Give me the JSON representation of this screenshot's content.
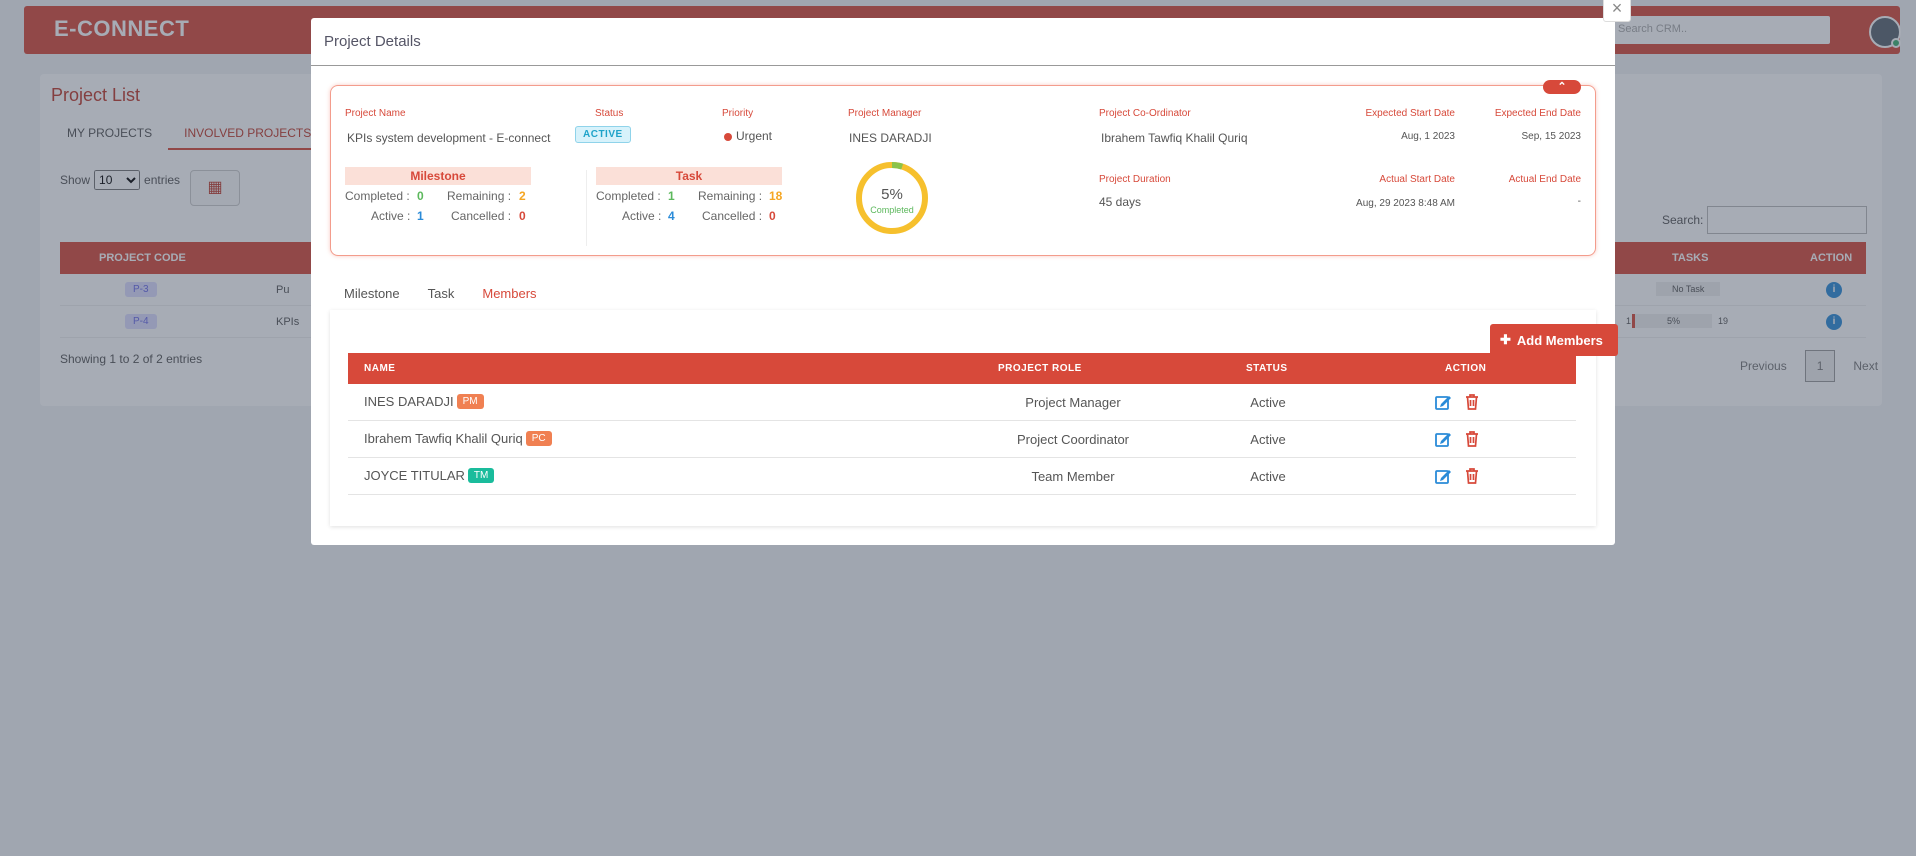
{
  "app": {
    "logo": "E-CONNECT",
    "search_placeholder": "Search CRM..",
    "accent": "#d7493a"
  },
  "background": {
    "title": "Project List",
    "tabs": [
      "MY PROJECTS",
      "INVOLVED PROJECTS"
    ],
    "show_label": "Show",
    "entries_value": "10",
    "entries_label": "entries",
    "search_label": "Search:",
    "columns": {
      "code": "PROJECT CODE",
      "tasks": "TASKS",
      "action": "ACTION"
    },
    "rows": [
      {
        "code": "P-3",
        "name": "Pu",
        "tasks": "No Task"
      },
      {
        "code": "P-4",
        "name": "KPIs",
        "tasks_left": "1",
        "tasks_pct": "5%",
        "tasks_right": "19"
      }
    ],
    "showing": "Showing 1 to 2 of 2 entries",
    "pager": {
      "previous": "Previous",
      "page": "1",
      "next": "Next"
    }
  },
  "modal": {
    "title": "Project Details",
    "close": "×",
    "project": {
      "name_label": "Project Name",
      "name": "KPIs system development - E-connect",
      "status_label": "Status",
      "status": "ACTIVE",
      "priority_label": "Priority",
      "priority": "Urgent",
      "manager_label": "Project Manager",
      "manager": "INES DARADJI",
      "coordinator_label": "Project Co-Ordinator",
      "coordinator": "Ibrahem Tawfiq Khalil Quriq",
      "exp_start_label": "Expected Start Date",
      "exp_start": "Aug, 1 2023",
      "exp_end_label": "Expected End Date",
      "exp_end": "Sep, 15 2023",
      "duration_label": "Project Duration",
      "duration": "45 days",
      "act_start_label": "Actual Start Date",
      "act_start": "Aug, 29 2023 8:48 AM",
      "act_end_label": "Actual End Date",
      "act_end": "-",
      "progress_pct": "5%",
      "progress_value": 5,
      "progress_label": "Completed"
    },
    "milestone": {
      "title": "Milestone",
      "completed_label": "Completed :",
      "completed": "0",
      "remaining_label": "Remaining :",
      "remaining": "2",
      "active_label": "Active :",
      "active": "1",
      "cancelled_label": "Cancelled :",
      "cancelled": "0"
    },
    "task": {
      "title": "Task",
      "completed_label": "Completed :",
      "completed": "1",
      "remaining_label": "Remaining :",
      "remaining": "18",
      "active_label": "Active :",
      "active": "4",
      "cancelled_label": "Cancelled :",
      "cancelled": "0"
    },
    "tabs": [
      "Milestone",
      "Task",
      "Members"
    ],
    "active_tab": "Members",
    "add_button": "Add Members",
    "members_columns": {
      "name": "NAME",
      "role": "PROJECT ROLE",
      "status": "STATUS",
      "action": "ACTION"
    },
    "members": [
      {
        "name": "INES DARADJI",
        "tag": "PM",
        "role": "Project Manager",
        "status": "Active"
      },
      {
        "name": "Ibrahem Tawfiq Khalil Quriq",
        "tag": "PC",
        "role": "Project Coordinator",
        "status": "Active"
      },
      {
        "name": "JOYCE TITULAR",
        "tag": "TM",
        "role": "Team Member",
        "status": "Active"
      }
    ]
  }
}
